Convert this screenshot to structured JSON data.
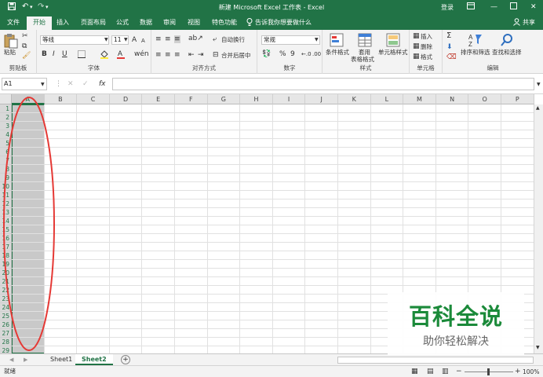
{
  "titlebar": {
    "title": "新建 Microsoft Excel 工作表 - Excel",
    "login": "登录",
    "qa_save_icon": "save-icon",
    "qa_undo_icon": "undo-icon",
    "qa_redo_icon": "redo-icon"
  },
  "tabs": {
    "file": "文件",
    "home": "开始",
    "insert": "插入",
    "page_layout": "页面布局",
    "formulas": "公式",
    "data": "数据",
    "review": "审阅",
    "view": "视图",
    "features": "特色功能",
    "tellme": "告诉我你想要做什么",
    "share": "共享"
  },
  "ribbon": {
    "clipboard": {
      "paste": "粘贴",
      "label": "剪贴板"
    },
    "font": {
      "name": "等线",
      "size": "11",
      "grow": "A",
      "shrink": "A",
      "bold": "B",
      "italic": "I",
      "underline": "U",
      "label": "字体"
    },
    "alignment": {
      "wrap": "自动换行",
      "merge": "合并后居中",
      "label": "对齐方式"
    },
    "number": {
      "format": "常规",
      "percent": "%",
      "comma": "9",
      "label": "数字"
    },
    "styles": {
      "conditional": "条件格式",
      "table_line1": "套用",
      "table_line2": "表格格式",
      "cell_styles": "单元格样式",
      "label": "样式"
    },
    "cells": {
      "insert": "插入",
      "delete": "删除",
      "format": "格式",
      "label": "单元格"
    },
    "editing": {
      "sort": "排序和筛选",
      "find": "查找和选择",
      "label": "编辑"
    }
  },
  "formulabar": {
    "namebox": "A1",
    "cancel": "✕",
    "enter": "✓",
    "fx": "fx",
    "formula_value": ""
  },
  "grid": {
    "columns": [
      "A",
      "B",
      "C",
      "D",
      "E",
      "F",
      "G",
      "H",
      "I",
      "J",
      "K",
      "L",
      "M",
      "N",
      "O",
      "P"
    ],
    "rows": [
      "1",
      "2",
      "3",
      "4",
      "5",
      "6",
      "7",
      "8",
      "9",
      "10",
      "11",
      "12",
      "13",
      "14",
      "15",
      "16",
      "17",
      "18",
      "19",
      "20",
      "21",
      "22",
      "23",
      "24",
      "25",
      "26",
      "27",
      "28",
      "29"
    ],
    "selected_column": "A"
  },
  "sheets": {
    "tabs": [
      "Sheet1",
      "Sheet2"
    ],
    "active": "Sheet2",
    "add": "+"
  },
  "statusbar": {
    "status": "就绪",
    "zoom_minus": "−",
    "zoom_plus": "+",
    "zoom": "100%"
  },
  "watermark": {
    "title": "百科全说",
    "subtitle": "助你轻松解决"
  },
  "colors": {
    "brand": "#217346",
    "annotation": "#e53935",
    "watermark_green": "#1b8a3a"
  }
}
